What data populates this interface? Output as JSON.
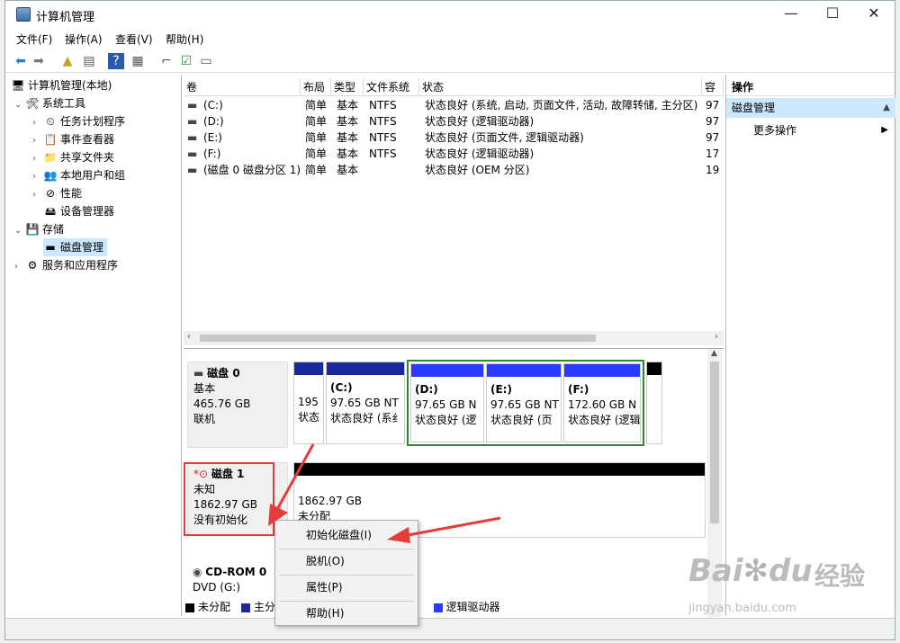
{
  "window": {
    "title": "计算机管理"
  },
  "winbtns": {
    "minimize": "—",
    "maximize": "☐",
    "close": "✕"
  },
  "menu": [
    "文件(F)",
    "操作(A)",
    "查看(V)",
    "帮助(H)"
  ],
  "tree": [
    {
      "label": "计算机管理(本地)",
      "expand": "",
      "icon": "🖥"
    },
    {
      "label": "系统工具",
      "expand": "⌄",
      "icon": "🛠"
    },
    {
      "label": "任务计划程序",
      "expand": "›",
      "icon": "⏲"
    },
    {
      "label": "事件查看器",
      "expand": "›",
      "icon": "📋"
    },
    {
      "label": "共享文件夹",
      "expand": "›",
      "icon": "📁"
    },
    {
      "label": "本地用户和组",
      "expand": "›",
      "icon": "👥"
    },
    {
      "label": "性能",
      "expand": "›",
      "icon": "⊘"
    },
    {
      "label": "设备管理器",
      "expand": "",
      "icon": "🖴"
    },
    {
      "label": "存储",
      "expand": "⌄",
      "icon": "💾"
    },
    {
      "label": "磁盘管理",
      "expand": "",
      "icon": "▬"
    },
    {
      "label": "服务和应用程序",
      "expand": "›",
      "icon": "⚙"
    }
  ],
  "volumes": {
    "headers": [
      "卷",
      "布局",
      "类型",
      "文件系统",
      "状态",
      "容"
    ],
    "rows": [
      [
        "(C:)",
        "简单",
        "基本",
        "NTFS",
        "状态良好 (系统, 启动, 页面文件, 活动, 故障转储, 主分区)",
        "97"
      ],
      [
        "(D:)",
        "简单",
        "基本",
        "NTFS",
        "状态良好 (逻辑驱动器)",
        "97"
      ],
      [
        "(E:)",
        "简单",
        "基本",
        "NTFS",
        "状态良好 (页面文件, 逻辑驱动器)",
        "97"
      ],
      [
        "(F:)",
        "简单",
        "基本",
        "NTFS",
        "状态良好 (逻辑驱动器)",
        "17"
      ],
      [
        "(磁盘 0 磁盘分区 1)",
        "简单",
        "基本",
        "",
        "状态良好 (OEM 分区)",
        "19"
      ]
    ]
  },
  "disk0": {
    "name": "磁盘 0",
    "type": "基本",
    "size": "465.76 GB",
    "status": "联机",
    "partitions": [
      {
        "name": "",
        "size": "195",
        "status": "状态"
      },
      {
        "name": "(C:)",
        "size": "97.65 GB NT",
        "status": "状态良好 (系纟"
      },
      {
        "name": "(D:)",
        "size": "97.65 GB N",
        "status": "状态良好 (逻"
      },
      {
        "name": "(E:)",
        "size": "97.65 GB NT",
        "status": "状态良好 (页"
      },
      {
        "name": "(F:)",
        "size": "172.60 GB N",
        "status": "状态良好 (逻辑"
      },
      {
        "name": "",
        "size": "",
        "status": ""
      }
    ]
  },
  "disk1": {
    "name": "磁盘 1",
    "type": "未知",
    "size": "1862.97 GB",
    "status": "没有初始化",
    "unalloc_size": "1862.97 GB",
    "unalloc_label": "未分配"
  },
  "cdrom": {
    "name": "CD-ROM 0",
    "drive": "DVD (G:)"
  },
  "legend": [
    {
      "label": "未分配",
      "color": "#000000"
    },
    {
      "label": "主分",
      "color": "#1a2a9a"
    },
    {
      "label": "逻辑驱动器",
      "color": "#2a3aff"
    }
  ],
  "context_menu": [
    "初始化磁盘(I)",
    "脱机(O)",
    "属性(P)",
    "帮助(H)"
  ],
  "actions": {
    "header": "操作",
    "selected": "磁盘管理",
    "more": "更多操作"
  },
  "watermark": {
    "brand": "Bai",
    "brand2": "du",
    "cn": "经验",
    "url": "jingyan.baidu.com"
  }
}
